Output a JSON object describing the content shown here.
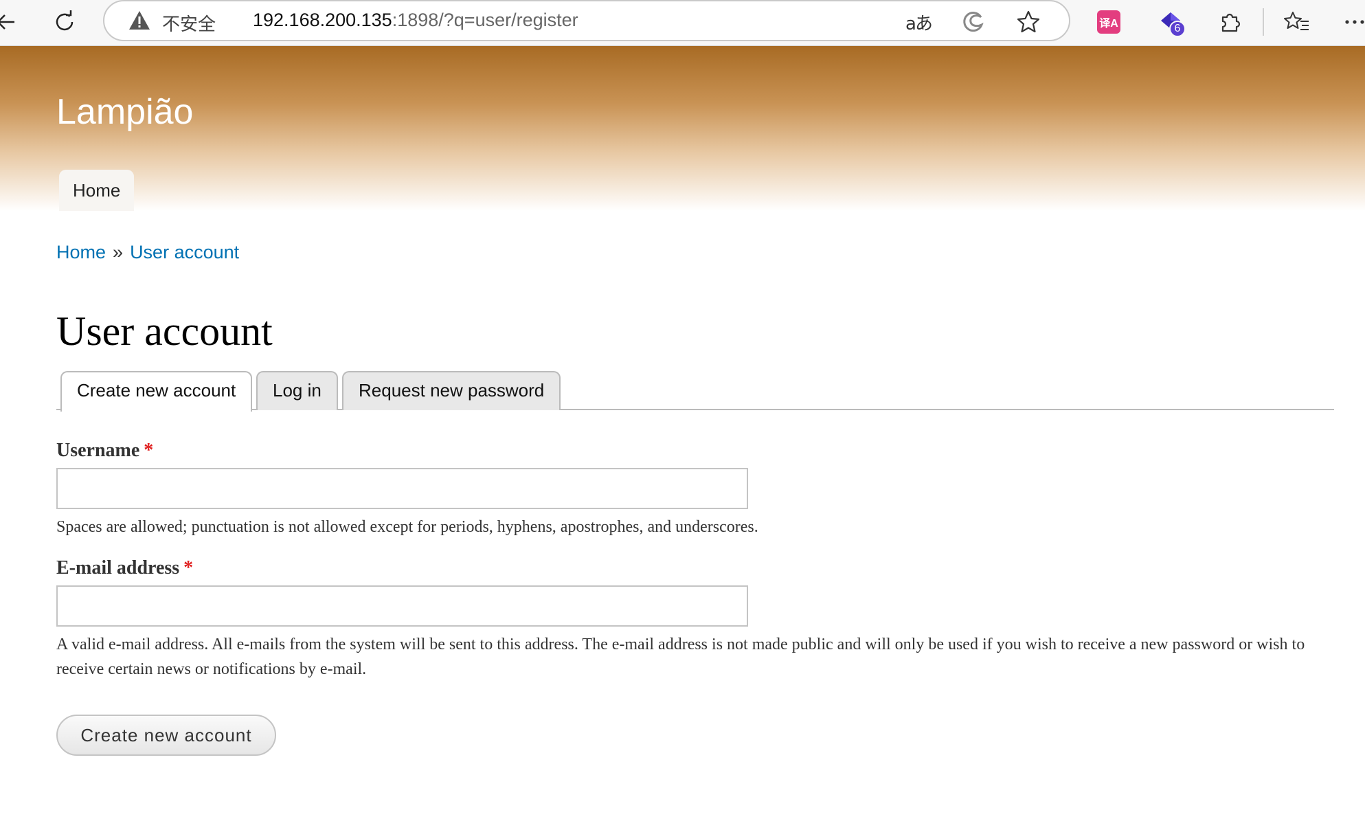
{
  "browser": {
    "security_label": "不安全",
    "url_host": "192.168.200.135",
    "url_rest": ":1898/?q=user/register",
    "translate_glyph": "aあ",
    "extension_translate_text": "译A",
    "extension_badge_count": "6",
    "icons": {
      "back": "back-arrow-icon",
      "reload": "reload-icon",
      "warning": "warning-icon",
      "translate": "translate-icon",
      "edge": "edge-icon",
      "favorite": "star-icon",
      "extensions": "puzzle-icon",
      "favorites": "favorites-icon",
      "more": "more-icon"
    },
    "accent_colors": {
      "translate_ext": "#e33d7f",
      "badge": "#5b3fd0"
    }
  },
  "site": {
    "name": "Lampião",
    "menu": [
      {
        "label": "Home"
      }
    ],
    "header_gradient_top": "#a86b24",
    "link_color": "#0071b3"
  },
  "breadcrumb": {
    "items": [
      {
        "label": "Home"
      },
      {
        "label": "User account"
      }
    ],
    "separator": "»"
  },
  "page": {
    "title": "User account",
    "tabs": [
      {
        "label": "Create new account",
        "active": true
      },
      {
        "label": "Log in",
        "active": false
      },
      {
        "label": "Request new password",
        "active": false
      }
    ]
  },
  "form": {
    "required_marker": "*",
    "username": {
      "label": "Username",
      "value": "",
      "description": "Spaces are allowed; punctuation is not allowed except for periods, hyphens, apostrophes, and underscores."
    },
    "email": {
      "label": "E-mail address",
      "value": "",
      "description": "A valid e-mail address. All e-mails from the system will be sent to this address. The e-mail address is not made public and will only be used if you wish to receive a new password or wish to receive certain news or notifications by e-mail."
    },
    "submit_label": "Create new account"
  }
}
